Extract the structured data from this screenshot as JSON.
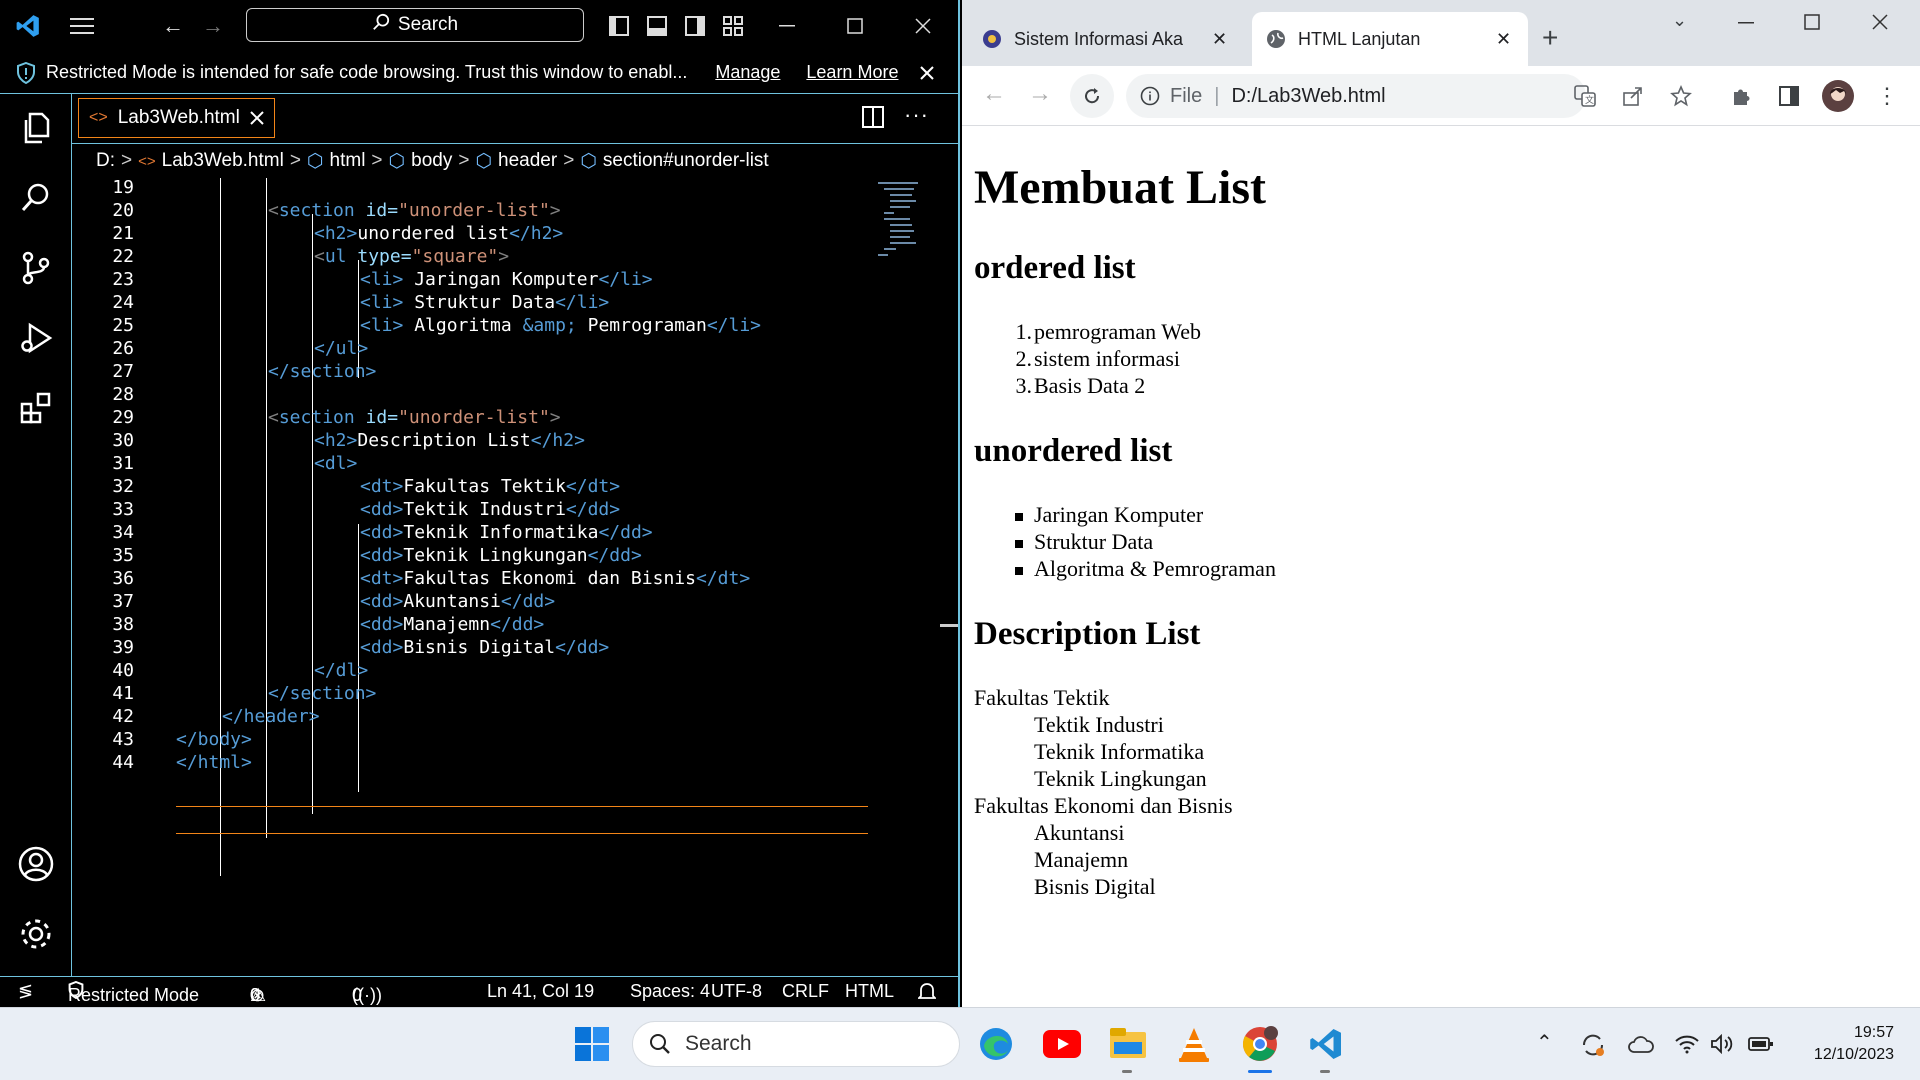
{
  "vscode": {
    "search_label": "Search",
    "banner": {
      "text": "Restricted Mode is intended for safe code browsing. Trust this window to enabl...",
      "manage": "Manage",
      "learn_more": "Learn More"
    },
    "tab_label": "Lab3Web.html",
    "breadcrumb": [
      "D:",
      "Lab3Web.html",
      "html",
      "body",
      "header",
      "section#unorder-list"
    ],
    "status": {
      "restricted": "Restricted Mode",
      "errors": "0",
      "warnings": "0",
      "ports": "0",
      "position": "Ln 41, Col 19",
      "spaces": "Spaces: 4",
      "encoding": "UTF-8",
      "eol": "CRLF",
      "language": "HTML"
    },
    "line_numbers": [
      "19",
      "20",
      "21",
      "22",
      "23",
      "24",
      "25",
      "26",
      "27",
      "28",
      "29",
      "30",
      "31",
      "32",
      "33",
      "34",
      "35",
      "36",
      "37",
      "38",
      "39",
      "40",
      "41",
      "42",
      "43",
      "44"
    ],
    "code": {
      "l20": {
        "open": "<",
        "tag": "section",
        "attr": " id=",
        "val": "\"unorder-list\"",
        "close": ">"
      },
      "l21": {
        "tag1": "<h2>",
        "text": "unordered list",
        "tag2": "</h2>"
      },
      "l22": {
        "open": "<",
        "tag": "ul",
        "attr": " type=",
        "val": "\"square\"",
        "close": ">"
      },
      "l23": {
        "tag1": "<li>",
        "text": " Jaringan Komputer",
        "tag2": "</li>"
      },
      "l24": {
        "tag1": "<li>",
        "text": " Struktur Data",
        "tag2": "</li>"
      },
      "l25": {
        "tag1": "<li>",
        "text": " Algoritma ",
        "entity": "&amp;",
        "text2": " Pemrograman",
        "tag2": "</li>"
      },
      "l26": "</ul>",
      "l27": "</section>",
      "l29": {
        "open": "<",
        "tag": "section",
        "attr": " id=",
        "val": "\"unorder-list\"",
        "close": ">"
      },
      "l30": {
        "tag1": "<h2>",
        "text": "Description List",
        "tag2": "</h2>"
      },
      "l31": "<dl>",
      "l32": {
        "tag1": "<dt>",
        "text": "Fakultas Tektik",
        "tag2": "</dt>"
      },
      "l33": {
        "tag1": "<dd>",
        "text": "Tektik Industri",
        "tag2": "</dd>"
      },
      "l34": {
        "tag1": "<dd>",
        "text": "Teknik Informatika",
        "tag2": "</dd>"
      },
      "l35": {
        "tag1": "<dd>",
        "text": "Teknik Lingkungan",
        "tag2": "</dd>"
      },
      "l36": {
        "tag1": "<dt>",
        "text": "Fakultas Ekonomi dan Bisnis",
        "tag2": "</dt>"
      },
      "l37": {
        "tag1": "<dd>",
        "text": "Akuntansi",
        "tag2": "</dd>"
      },
      "l38": {
        "tag1": "<dd>",
        "text": "Manajemn",
        "tag2": "</dd>"
      },
      "l39": {
        "tag1": "<dd>",
        "text": "Bisnis Digital",
        "tag2": "</dd>"
      },
      "l40": "</dl>",
      "l41": "</section>",
      "l42": "</header>",
      "l43": "</body>",
      "l44": "</html>"
    },
    "colors": {
      "accent": "#6fc3df",
      "active_border": "#f38518",
      "tag": "#569cd6",
      "attr": "#9cdcfe",
      "string": "#ce9178"
    }
  },
  "chrome": {
    "tabs": [
      {
        "label": "Sistem Informasi Aka",
        "active": false
      },
      {
        "label": "HTML Lanjutan",
        "active": true
      }
    ],
    "omnibox": {
      "scheme": "File",
      "url": "D:/Lab3Web.html"
    },
    "page": {
      "h1": "Membuat List",
      "ordered_title": "ordered list",
      "ordered": [
        "pemrograman Web",
        "sistem informasi",
        "Basis Data 2"
      ],
      "ordered_markers": [
        "1.",
        "2.",
        "3."
      ],
      "unordered_title": "unordered list",
      "unordered": [
        "Jaringan Komputer",
        "Struktur Data",
        "Algoritma & Pemrograman"
      ],
      "desc_title": "Description List",
      "desc": [
        {
          "dt": "Fakultas Tektik",
          "dd": [
            "Tektik Industri",
            "Teknik Informatika",
            "Teknik Lingkungan"
          ]
        },
        {
          "dt": "Fakultas Ekonomi dan Bisnis",
          "dd": [
            "Akuntansi",
            "Manajemn",
            "Bisnis Digital"
          ]
        }
      ]
    }
  },
  "taskbar": {
    "search_label": "Search",
    "time": "19:57",
    "date": "12/10/2023"
  }
}
